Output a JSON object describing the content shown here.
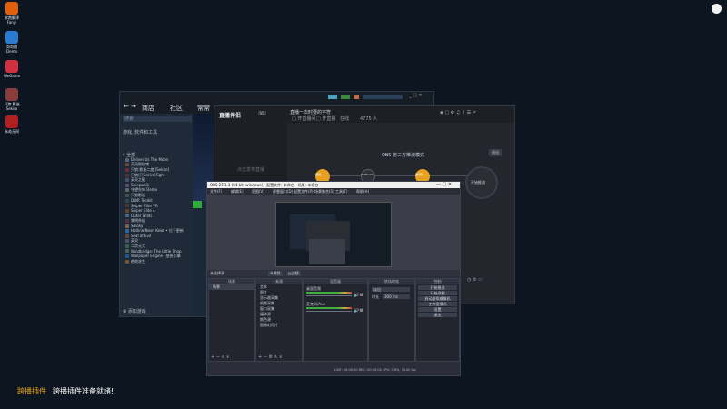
{
  "desktop": {
    "icons": [
      {
        "label": "奔跑翻译 Fanyi",
        "color": "#e06010"
      },
      {
        "label": "哥哥翻 Demo",
        "color": "#2a7ad0"
      },
      {
        "label": "WeGame",
        "color": "#d03040"
      },
      {
        "label": "只狼:影逝 Sekiro",
        "color": "#8a3c3c"
      },
      {
        "label": "永劫无间",
        "color": "#b02020"
      }
    ]
  },
  "steam": {
    "nav": [
      "商店",
      "社区",
      "常常"
    ],
    "search_placeholder": "搜索",
    "filter_label": "游戏, 软件和工具",
    "category": "▾ 全部",
    "games": [
      {
        "name": "Deliver Us The Moon",
        "color": "#556677"
      },
      {
        "name": "英灵殿惊魂",
        "color": "#664433"
      },
      {
        "name": "只狼:影逝二度 [Sekiro]",
        "color": "#6b3030"
      },
      {
        "name": "只狼(只Sekiro)Fight",
        "color": "#553333"
      },
      {
        "name": "英灵之殿",
        "color": "#445566"
      },
      {
        "name": "Sleepwalk",
        "color": "#5a4a6a"
      },
      {
        "name": "守望先锋 Demo",
        "color": "#666666"
      },
      {
        "name": "只狼影逝",
        "color": "#445544"
      },
      {
        "name": "DWR Toolkit",
        "color": "#334455"
      },
      {
        "name": "Sniper Elite VR",
        "color": "#553322"
      },
      {
        "name": "Sniper Elite 4",
        "color": "#664422"
      },
      {
        "name": "Outer Wilds",
        "color": "#446688"
      },
      {
        "name": "黎明杀机",
        "color": "#553344"
      },
      {
        "name": "Smoky",
        "color": "#776655"
      },
      {
        "name": "Hotline Neon Kewt • 位于更新",
        "color": "#2a6aa0"
      },
      {
        "name": "Seal of Evil",
        "color": "#664433"
      },
      {
        "name": "英灵",
        "color": "#445566"
      },
      {
        "name": "二次元大",
        "color": "#336644"
      },
      {
        "name": "Windbridge: The Little Shop",
        "color": "#446655"
      },
      {
        "name": "Wallpaper Engine · 壁纸引擎",
        "color": "#225588"
      },
      {
        "name": "绝地求生",
        "color": "#775533"
      }
    ],
    "add_game": "添加游戏"
  },
  "wegame": {
    "app_name": "直播伴侣",
    "badge": "V1",
    "header_text": "直播一次时要的字符",
    "tags": [
      "□ 开直播间",
      "□ 开直播",
      "在线",
      "4775 人"
    ],
    "left_text": "点击发布直播",
    "mode_title": "OBS 第三方推流模式",
    "mode_button": "退出",
    "nodes": [
      "推流",
      "RTMP URL",
      "推流码",
      "开始推流"
    ]
  },
  "obs": {
    "title": "OBS 27.1.3 (64 bit, windows) - 配置文件: 未命名 - 场景: 未命名",
    "menu": [
      "文件(F)",
      "编辑(E)",
      "视图(V)",
      "停靠窗口(D)",
      "配置文件(P)",
      "场景集合(S)",
      "工具(T)",
      "帮助(H)"
    ],
    "source_toolbar": "未选择源",
    "toolbar_buttons": [
      "属性",
      "滤镜"
    ],
    "panels": {
      "scenes": "场景",
      "sources": "来源",
      "mixer": "混音器",
      "transitions": "转场特效",
      "controls": "控制"
    },
    "scene_items": [
      "场景"
    ],
    "source_items": [
      "文本",
      "图片",
      "显示器采集",
      "视频采集",
      "窗口采集",
      "媒体源",
      "颜色源",
      "图像幻灯片"
    ],
    "mixer_tracks": [
      "桌面音频",
      "麦克风/Aux"
    ],
    "transition": "淡出",
    "duration_label": "时长",
    "duration": "300 ms",
    "control_buttons": [
      "开始推流",
      "开始录制",
      "启动虚拟摄像机",
      "工作室模式",
      "设置",
      "退出"
    ],
    "status": "LIVE: 00:00:00  REC: 00:00:00  CPU: 0.8%, 30.00 fps"
  },
  "notification": {
    "label": "跨播插件",
    "message": "跨播插件准备就绪!"
  },
  "colors": {
    "accent": "#1f7adc",
    "green": "#2ea83a",
    "orange": "#e8a020",
    "steam_bg": "#1b2838",
    "obs_bg": "#2b2e38"
  }
}
